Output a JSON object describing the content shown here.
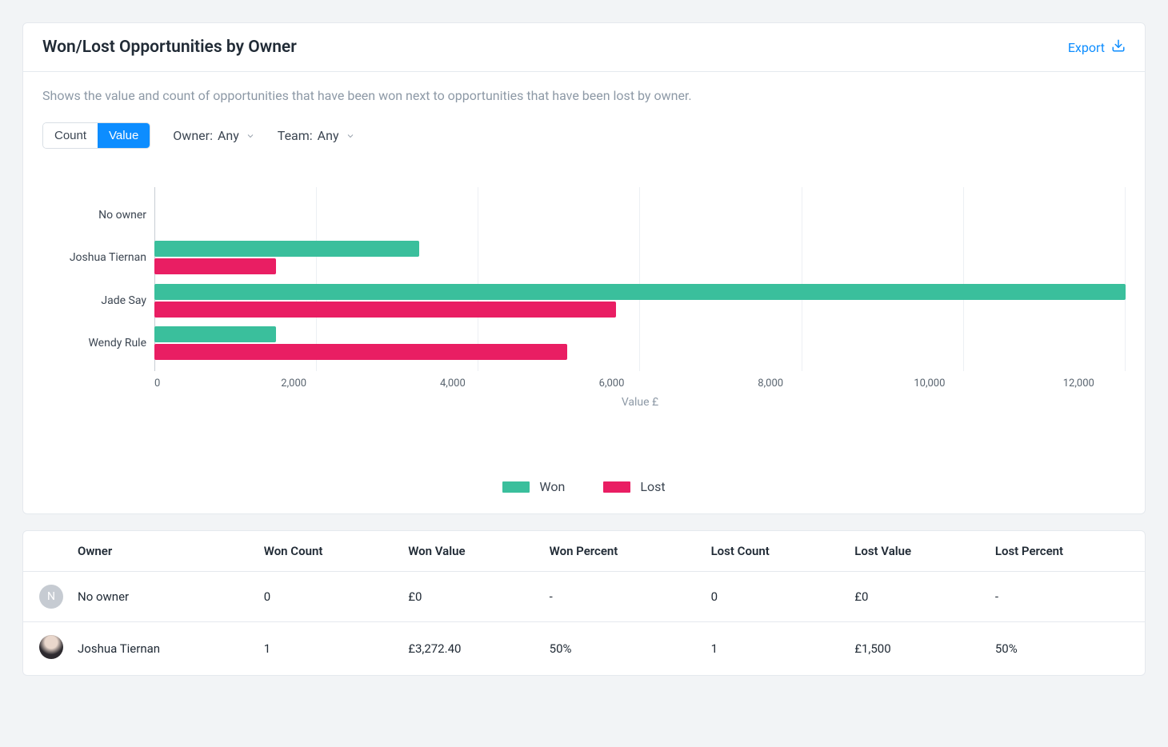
{
  "header": {
    "title": "Won/Lost Opportunities by Owner",
    "export_label": "Export"
  },
  "description": "Shows the value and count of opportunities that have been won next to opportunities that have been lost by owner.",
  "controls": {
    "toggle": {
      "count": "Count",
      "value": "Value",
      "active": "value"
    },
    "owner_filter": {
      "label": "Owner:",
      "value": "Any"
    },
    "team_filter": {
      "label": "Team:",
      "value": "Any"
    }
  },
  "chart_data": {
    "type": "bar",
    "orientation": "horizontal",
    "categories": [
      "No owner",
      "Joshua Tiernan",
      "Jade Say",
      "Wendy Rule"
    ],
    "series": [
      {
        "name": "Won",
        "values": [
          0,
          3272,
          12000,
          1500
        ]
      },
      {
        "name": "Lost",
        "values": [
          0,
          1500,
          5700,
          5100
        ]
      }
    ],
    "xlabel": "Value £",
    "xlim": [
      0,
      12000
    ],
    "ticks": [
      0,
      2000,
      4000,
      6000,
      8000,
      10000,
      12000
    ],
    "tick_labels": [
      "0",
      "2,000",
      "4,000",
      "6,000",
      "8,000",
      "10,000",
      "12,000"
    ],
    "colors": {
      "Won": "#3abf9c",
      "Lost": "#e91e63"
    },
    "legend": [
      "Won",
      "Lost"
    ]
  },
  "table": {
    "columns": [
      "Owner",
      "Won Count",
      "Won Value",
      "Won Percent",
      "Lost Count",
      "Lost Value",
      "Lost Percent"
    ],
    "rows": [
      {
        "avatar": {
          "kind": "initial",
          "initial": "N"
        },
        "cells": [
          "No owner",
          "0",
          "£0",
          "-",
          "0",
          "£0",
          "-"
        ]
      },
      {
        "avatar": {
          "kind": "photo"
        },
        "cells": [
          "Joshua Tiernan",
          "1",
          "£3,272.40",
          "50%",
          "1",
          "£1,500",
          "50%"
        ]
      }
    ]
  }
}
